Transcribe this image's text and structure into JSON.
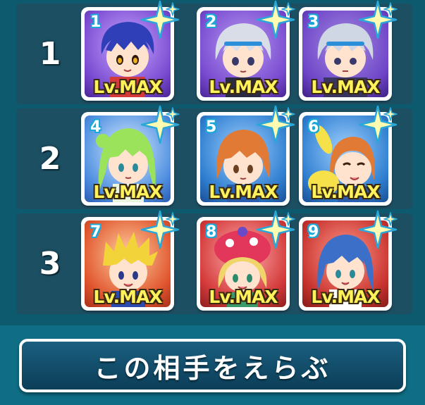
{
  "rows": [
    {
      "label": "1"
    },
    {
      "label": "2"
    },
    {
      "label": "3"
    }
  ],
  "cards": [
    {
      "slot": "1",
      "level": "Lv.MAX",
      "frame_color": "#7a4bd1",
      "hair_color": "#2f3fb8",
      "icon": "sparkle-icon"
    },
    {
      "slot": "2",
      "level": "Lv.MAX",
      "frame_color": "#7a4bd1",
      "hair_color": "#d9dde8",
      "icon": "sparkle-icon"
    },
    {
      "slot": "3",
      "level": "Lv.MAX",
      "frame_color": "#6e45c8",
      "hair_color": "#cfd6e4",
      "icon": "sparkle-icon"
    },
    {
      "slot": "4",
      "level": "Lv.MAX",
      "frame_color": "#4f8fe0",
      "hair_color": "#9be35a",
      "icon": "sparkle-icon"
    },
    {
      "slot": "5",
      "level": "Lv.MAX",
      "frame_color": "#2f7ed0",
      "hair_color": "#e07a35",
      "icon": "sparkle-icon"
    },
    {
      "slot": "6",
      "level": "Lv.MAX",
      "frame_color": "#2f7ed0",
      "hair_color": "#e07a35",
      "icon": "sparkle-icon"
    },
    {
      "slot": "7",
      "level": "Lv.MAX",
      "frame_color": "#e0552e",
      "hair_color": "#f2d33a",
      "icon": "sparkle-icon"
    },
    {
      "slot": "8",
      "level": "Lv.MAX",
      "frame_color": "#d43a3a",
      "hair_color": "#f0d56a",
      "icon": "sparkle-icon"
    },
    {
      "slot": "9",
      "level": "Lv.MAX",
      "frame_color": "#c8332f",
      "hair_color": "#3c6fc8",
      "icon": "sparkle-icon"
    }
  ],
  "button": {
    "label": "この相手をえらぶ"
  },
  "colors": {
    "background": "#0f6e85",
    "row": "#1d4f63",
    "level_text": "#fff25a"
  }
}
